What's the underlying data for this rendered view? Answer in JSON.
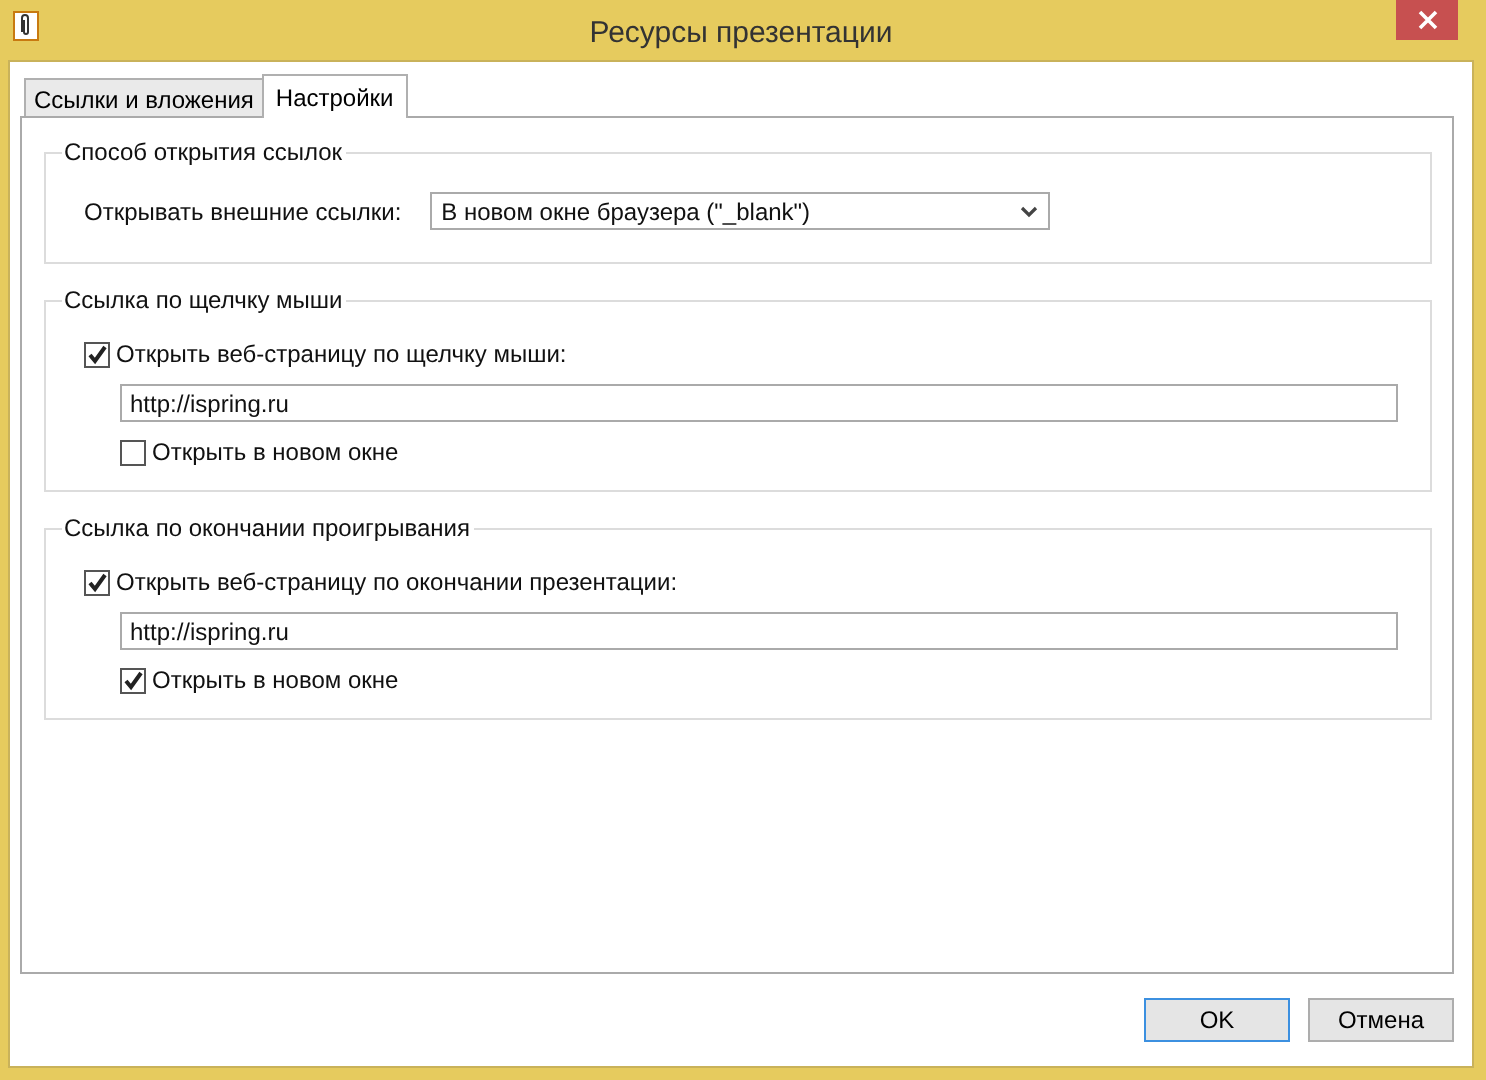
{
  "window": {
    "title": "Ресурсы презентации"
  },
  "tabs": [
    {
      "label": "Ссылки и вложения",
      "selected": false
    },
    {
      "label": "Настройки",
      "selected": true
    }
  ],
  "groups": [
    {
      "title": "Способ открытия ссылок",
      "items": [
        {
          "kind": "dropdown",
          "label": "Открывать внешние ссылки:",
          "value": "В новом окне браузера (\"_blank\")"
        }
      ]
    },
    {
      "title": "Ссылка по щелчку мыши",
      "items": [
        {
          "kind": "checkbox",
          "label": "Открыть веб-страницу по щелчку мыши:",
          "checked": true
        },
        {
          "kind": "field",
          "value": "http://ispring.ru"
        },
        {
          "kind": "option",
          "label": "Открыть в новом окне",
          "checked": false
        }
      ]
    },
    {
      "title": "Ссылка по окончании проигрывания",
      "items": [
        {
          "kind": "checkbox",
          "label": "Открыть веб-страницу по окончании презентации:",
          "checked": true
        },
        {
          "kind": "field",
          "value": "http://ispring.ru"
        },
        {
          "kind": "option",
          "label": "Открыть в новом окне",
          "checked": true
        }
      ]
    }
  ],
  "buttons": [
    {
      "label": "OK",
      "default": true
    },
    {
      "label": "Отмена",
      "default": false
    }
  ]
}
